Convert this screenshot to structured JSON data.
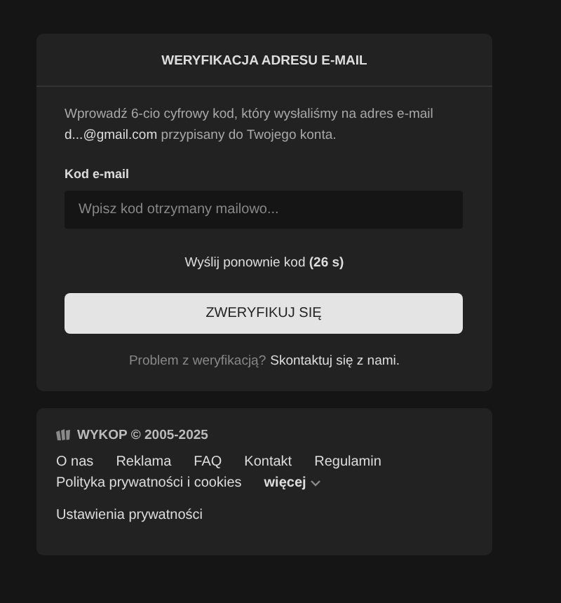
{
  "card": {
    "title": "WERYFIKACJA ADRESU E-MAIL",
    "intro": "Wprowadź 6-cio cyfrowy kod, który wysłaliśmy na adres e-mail **d...@gmail.com** przypisany do Twojego konta.",
    "field": {
      "label": "Kod e-mail",
      "placeholder": "Wpisz kod otrzymany mailowo..."
    },
    "resend": "Wyślij ponownie kod **(26 s)**",
    "submit": "ZWERYFIKUJ SIĘ",
    "problem": {
      "text": "Problem z weryfikacją?",
      "link": "Skontaktuj się z nami."
    }
  },
  "footer": {
    "brand": "WYKOP © 2005-2025",
    "links": [
      {
        "label": "O nas",
        "kind": "link"
      },
      {
        "label": "Reklama",
        "kind": "link"
      },
      {
        "label": "FAQ",
        "kind": "link"
      },
      {
        "label": "Kontakt",
        "kind": "link"
      },
      {
        "label": "Regulamin",
        "kind": "link"
      },
      {
        "label": "Polityka prywatności i cookies",
        "kind": "link"
      },
      {
        "label": "więcej",
        "kind": "more"
      }
    ],
    "settings": "Ustawienia prywatności"
  }
}
